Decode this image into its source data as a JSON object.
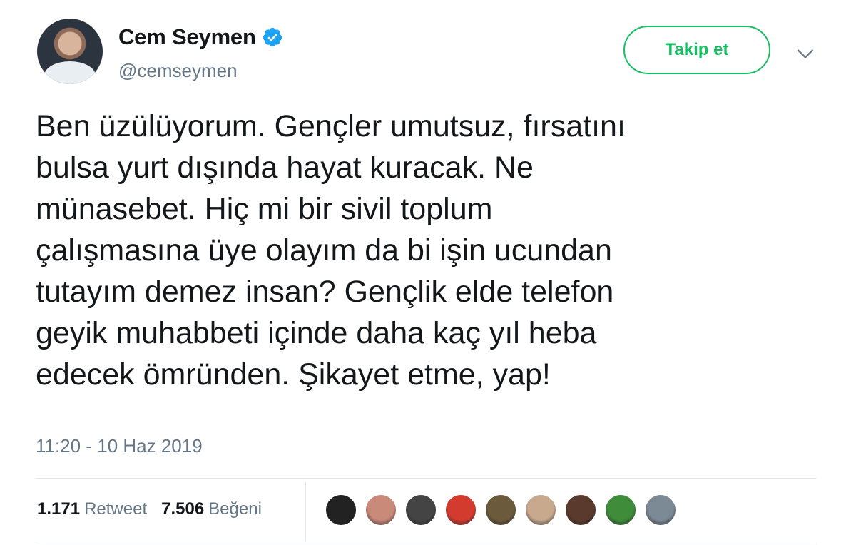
{
  "user": {
    "name": "Cem Seymen",
    "handle": "@cemseymen",
    "verified_icon": "verified-badge-icon",
    "verified_color": "#1da1f2"
  },
  "actions": {
    "follow_label": "Takip et",
    "follow_color": "#17bf63",
    "menu_icon": "chevron-down-icon"
  },
  "tweet": {
    "lines": [
      "Ben üzülüyorum. Gençler umutsuz, fırsatını",
      "bulsa yurt dışında hayat kuracak. Ne",
      "münasebet. Hiç mi bir sivil toplum",
      "çalışmasına üye olayım da bi işin ucundan",
      "tutayım demez insan? Gençlik elde telefon",
      "geyik muhabbeti içinde daha kaç yıl heba",
      "edecek ömründen. Şikayet etme, yap!"
    ],
    "timestamp": "11:20 - 10 Haz 2019"
  },
  "stats": {
    "retweet_count": "1.171",
    "retweet_label": "Retweet",
    "like_count": "7.506",
    "like_label": "Beğeni"
  },
  "likers": [
    {
      "name": "liker-avatar",
      "color": "#222222"
    },
    {
      "name": "liker-avatar",
      "color": "#c98a7a"
    },
    {
      "name": "liker-avatar",
      "color": "#444444"
    },
    {
      "name": "liker-avatar",
      "color": "#d43b2f"
    },
    {
      "name": "liker-avatar",
      "color": "#6b5a3c"
    },
    {
      "name": "liker-avatar",
      "color": "#c9a98e"
    },
    {
      "name": "liker-avatar",
      "color": "#5a3a2c"
    },
    {
      "name": "liker-avatar",
      "color": "#3f8c3a"
    },
    {
      "name": "liker-avatar",
      "color": "#7c8a96"
    }
  ]
}
